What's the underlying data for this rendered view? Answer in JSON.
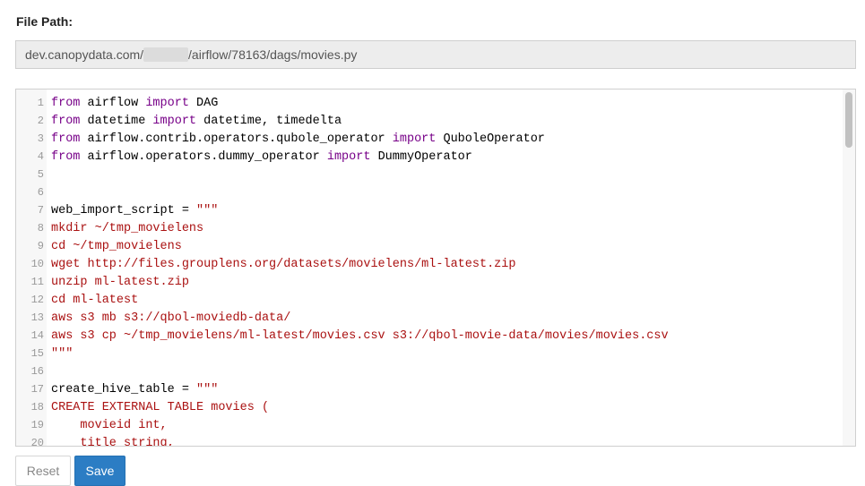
{
  "file_path": {
    "label": "File Path:",
    "prefix": "dev.canopydata.com/",
    "suffix": "/airflow/78163/dags/movies.py"
  },
  "editor": {
    "lines": [
      {
        "n": "1",
        "t": [
          [
            "kw",
            "from"
          ],
          [
            "tx",
            " airflow "
          ],
          [
            "kw",
            "import"
          ],
          [
            "tx",
            " DAG"
          ]
        ]
      },
      {
        "n": "2",
        "t": [
          [
            "kw",
            "from"
          ],
          [
            "tx",
            " datetime "
          ],
          [
            "kw",
            "import"
          ],
          [
            "tx",
            " datetime, timedelta"
          ]
        ]
      },
      {
        "n": "3",
        "t": [
          [
            "kw",
            "from"
          ],
          [
            "tx",
            " airflow.contrib.operators.qubole_operator "
          ],
          [
            "kw",
            "import"
          ],
          [
            "tx",
            " QuboleOperator"
          ]
        ]
      },
      {
        "n": "4",
        "t": [
          [
            "kw",
            "from"
          ],
          [
            "tx",
            " airflow.operators.dummy_operator "
          ],
          [
            "kw",
            "import"
          ],
          [
            "tx",
            " DummyOperator"
          ]
        ]
      },
      {
        "n": "5",
        "t": []
      },
      {
        "n": "6",
        "t": []
      },
      {
        "n": "7",
        "t": [
          [
            "tx",
            "web_import_script = "
          ],
          [
            "st",
            "\"\"\""
          ]
        ]
      },
      {
        "n": "8",
        "t": [
          [
            "st",
            "mkdir ~/tmp_movielens"
          ]
        ]
      },
      {
        "n": "9",
        "t": [
          [
            "st",
            "cd ~/tmp_movielens"
          ]
        ]
      },
      {
        "n": "10",
        "t": [
          [
            "st",
            "wget http://files.grouplens.org/datasets/movielens/ml-latest.zip"
          ]
        ]
      },
      {
        "n": "11",
        "t": [
          [
            "st",
            "unzip ml-latest.zip"
          ]
        ]
      },
      {
        "n": "12",
        "t": [
          [
            "st",
            "cd ml-latest"
          ]
        ]
      },
      {
        "n": "13",
        "t": [
          [
            "st",
            "aws s3 mb s3://qbol-moviedb-data/"
          ]
        ]
      },
      {
        "n": "14",
        "t": [
          [
            "st",
            "aws s3 cp ~/tmp_movielens/ml-latest/movies.csv s3://qbol-movie-data/movies/movies.csv"
          ]
        ]
      },
      {
        "n": "15",
        "t": [
          [
            "st",
            "\"\"\""
          ]
        ]
      },
      {
        "n": "16",
        "t": []
      },
      {
        "n": "17",
        "t": [
          [
            "tx",
            "create_hive_table = "
          ],
          [
            "st",
            "\"\"\""
          ]
        ]
      },
      {
        "n": "18",
        "t": [
          [
            "st",
            "CREATE EXTERNAL TABLE movies ("
          ]
        ]
      },
      {
        "n": "19",
        "t": [
          [
            "st",
            "    movieid int,"
          ]
        ]
      },
      {
        "n": "20",
        "t": [
          [
            "st",
            "    title string,"
          ]
        ]
      }
    ]
  },
  "buttons": {
    "reset": "Reset",
    "save": "Save"
  }
}
